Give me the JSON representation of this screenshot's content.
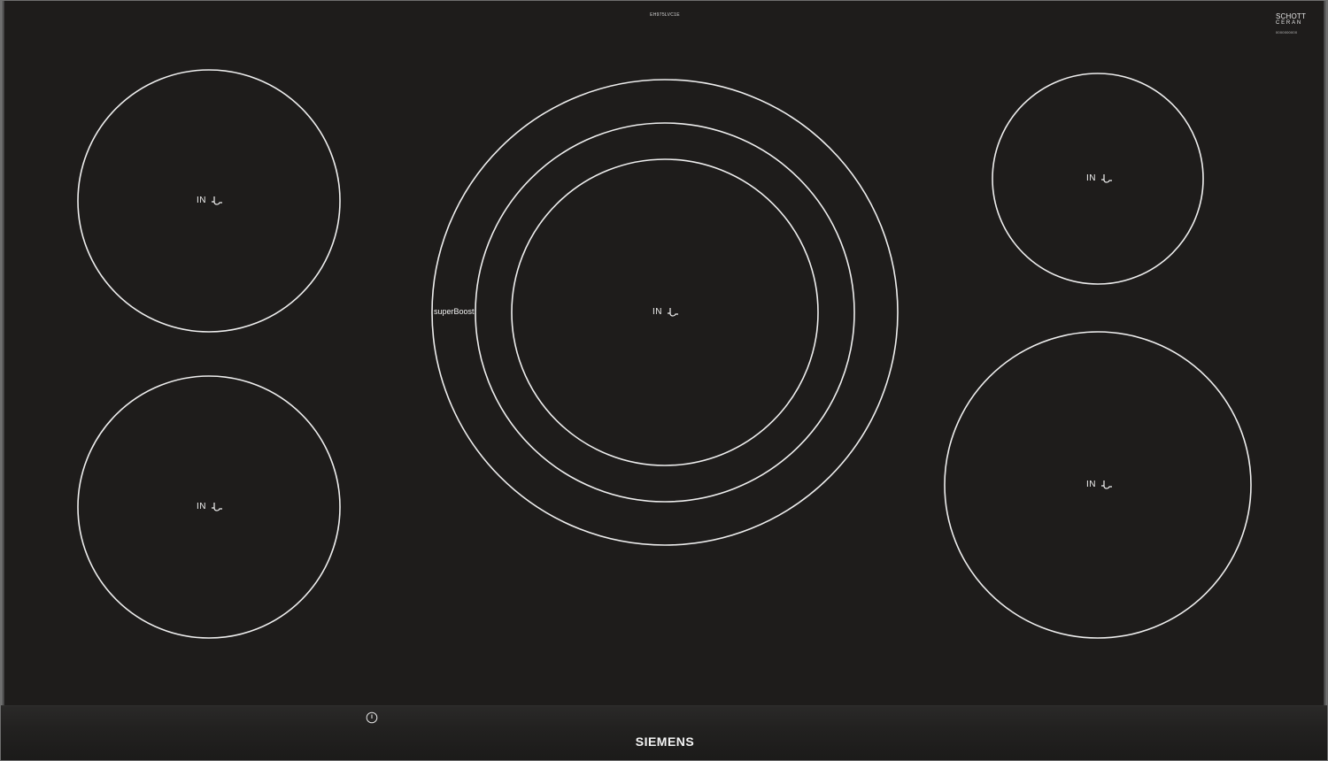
{
  "appliance": {
    "model_number": "EH975LVC1E",
    "brand": "SIEMENS",
    "glass_brand": {
      "line1": "SCHOTT",
      "line2": "CERAN",
      "code": "0000000000"
    },
    "colors": {
      "glass": "#1e1c1b",
      "zone_lines": "#eeeeee",
      "control_strip": "#222120",
      "frame": "#6e6e6e"
    }
  },
  "zones": [
    {
      "id": "front-left",
      "label": "IN",
      "icon": "induction-icon"
    },
    {
      "id": "rear-left",
      "label": "IN",
      "icon": "induction-icon"
    },
    {
      "id": "center",
      "label": "IN",
      "icon": "induction-icon",
      "rings": 3,
      "boost_label": "superBoost"
    },
    {
      "id": "rear-right",
      "label": "IN",
      "icon": "induction-icon"
    },
    {
      "id": "front-right",
      "label": "IN",
      "icon": "induction-icon"
    }
  ],
  "controls": {
    "power_icon": "power-icon"
  }
}
